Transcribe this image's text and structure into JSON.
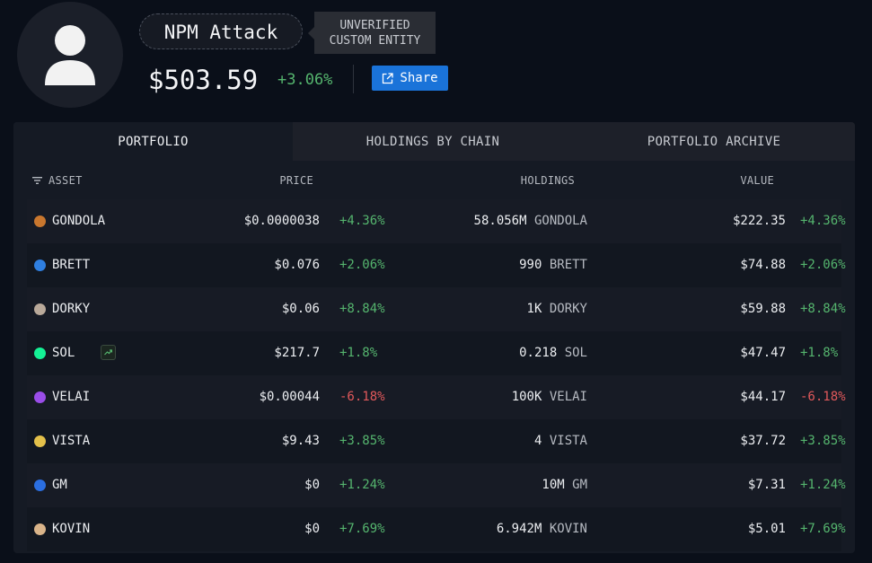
{
  "entity": {
    "name": "NPM Attack",
    "badge_line1": "UNVERIFIED",
    "badge_line2": "CUSTOM ENTITY",
    "total_value": "$503.59",
    "total_change": "+3.06%",
    "share_label": "Share"
  },
  "tabs": [
    {
      "label": "PORTFOLIO",
      "active": true
    },
    {
      "label": "HOLDINGS BY CHAIN",
      "active": false
    },
    {
      "label": "PORTFOLIO ARCHIVE",
      "active": false
    }
  ],
  "columns": {
    "asset": "ASSET",
    "price": "PRICE",
    "holdings": "HOLDINGS",
    "value": "VALUE"
  },
  "rows": [
    {
      "symbol": "GONDOLA",
      "icon": "gondola-token-icon",
      "icon_color": "#c9772e",
      "price": "$0.0000038",
      "price_change": "+4.36%",
      "holdings_amount": "58.056M",
      "holdings_unit": "GONDOLA",
      "value": "$222.35",
      "value_change": "+4.36%",
      "direction": "up"
    },
    {
      "symbol": "BRETT",
      "icon": "brett-token-icon",
      "icon_color": "#2f7fe0",
      "price": "$0.076",
      "price_change": "+2.06%",
      "holdings_amount": "990",
      "holdings_unit": "BRETT",
      "value": "$74.88",
      "value_change": "+2.06%",
      "direction": "up"
    },
    {
      "symbol": "DORKY",
      "icon": "dorky-token-icon",
      "icon_color": "#b9a99a",
      "price": "$0.06",
      "price_change": "+8.84%",
      "holdings_amount": "1K",
      "holdings_unit": "DORKY",
      "value": "$59.88",
      "value_change": "+8.84%",
      "direction": "up"
    },
    {
      "symbol": "SOL",
      "icon": "solana-token-icon",
      "icon_color": "#14f195",
      "price": "$217.7",
      "price_change": "+1.8%",
      "holdings_amount": "0.218",
      "holdings_unit": "SOL",
      "value": "$47.47",
      "value_change": "+1.8%",
      "direction": "up",
      "has_trend": true
    },
    {
      "symbol": "VELAI",
      "icon": "velai-token-icon",
      "icon_color": "#9a4de8",
      "price": "$0.00044",
      "price_change": "-6.18%",
      "holdings_amount": "100K",
      "holdings_unit": "VELAI",
      "value": "$44.17",
      "value_change": "-6.18%",
      "direction": "down"
    },
    {
      "symbol": "VISTA",
      "icon": "vista-token-icon",
      "icon_color": "#e3c04a",
      "price": "$9.43",
      "price_change": "+3.85%",
      "holdings_amount": "4",
      "holdings_unit": "VISTA",
      "value": "$37.72",
      "value_change": "+3.85%",
      "direction": "up"
    },
    {
      "symbol": "GM",
      "icon": "gm-token-icon",
      "icon_color": "#2b6ee0",
      "price": "$0",
      "price_change": "+1.24%",
      "holdings_amount": "10M",
      "holdings_unit": "GM",
      "value": "$7.31",
      "value_change": "+1.24%",
      "direction": "up"
    },
    {
      "symbol": "KOVIN",
      "icon": "kovin-token-icon",
      "icon_color": "#d9b48a",
      "price": "$0",
      "price_change": "+7.69%",
      "holdings_amount": "6.942M",
      "holdings_unit": "KOVIN",
      "value": "$5.01",
      "value_change": "+7.69%",
      "direction": "up"
    }
  ]
}
